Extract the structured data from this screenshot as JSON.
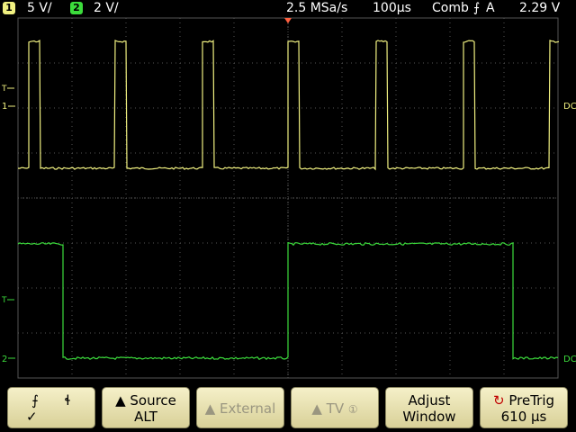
{
  "status": {
    "ch1_num": "1",
    "ch1_scale": "5 V/",
    "ch2_num": "2",
    "ch2_scale": "2 V/",
    "sample_rate": "2.5 MSa/s",
    "timebase": "100µs",
    "trigger_mode": "Comb",
    "trigger_source": "A",
    "trigger_level": "2.29 V"
  },
  "channels": {
    "ch1": {
      "color": "#f0f080",
      "label": "1",
      "coupling_marker": "DC"
    },
    "ch2": {
      "color": "#3cdc3c",
      "label": "2",
      "coupling_marker": "DC"
    }
  },
  "softkeys": {
    "slope": {
      "rising": "⨍",
      "falling": "ɬ",
      "check": "✓"
    },
    "source": {
      "line1": "▲ Source",
      "line2": "ALT"
    },
    "external": {
      "line1": "▲ External"
    },
    "tv": {
      "line1": "▲ TV",
      "icon": "①"
    },
    "adjust": {
      "line1": "Adjust",
      "line2": "Window"
    },
    "pretrig": {
      "line1": "PreTrig",
      "line2": "610 µs",
      "icon": "↻"
    }
  },
  "colors": {
    "grid": "#555555",
    "softkey_bg": "#e8e2b0",
    "ch1": "#f0f080",
    "ch2": "#3cdc3c",
    "trigger_marker": "#ff6040"
  }
}
